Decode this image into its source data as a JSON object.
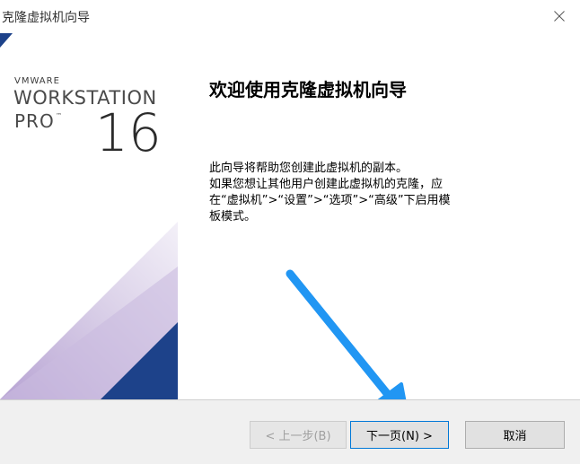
{
  "window": {
    "title": "克隆虚拟机向导",
    "close_icon": "close-icon"
  },
  "banner": {
    "vmware": "VMWARE",
    "workstation": "WORKSTATION",
    "pro": "PRO",
    "tm": "™",
    "version": "16",
    "colors": {
      "navy": "#1d428a",
      "lavender": "#b9a6d4",
      "light_lavender": "#e6e0ef"
    }
  },
  "content": {
    "heading": "欢迎使用克隆虚拟机向导",
    "paragraph1": "此向导将帮助您创建此虚拟机的副本。",
    "paragraph2": "如果您想让其他用户创建此虚拟机的克隆，应在“虚拟机”>“设置”>“选项”>“高级”下启用模板模式。"
  },
  "annotation": {
    "icon": "blue-arrow-icon",
    "color": "#2196f3"
  },
  "buttons": {
    "back_label": "< 上一步(B)",
    "next_label": "下一页(N) >",
    "cancel_label": "取消"
  }
}
